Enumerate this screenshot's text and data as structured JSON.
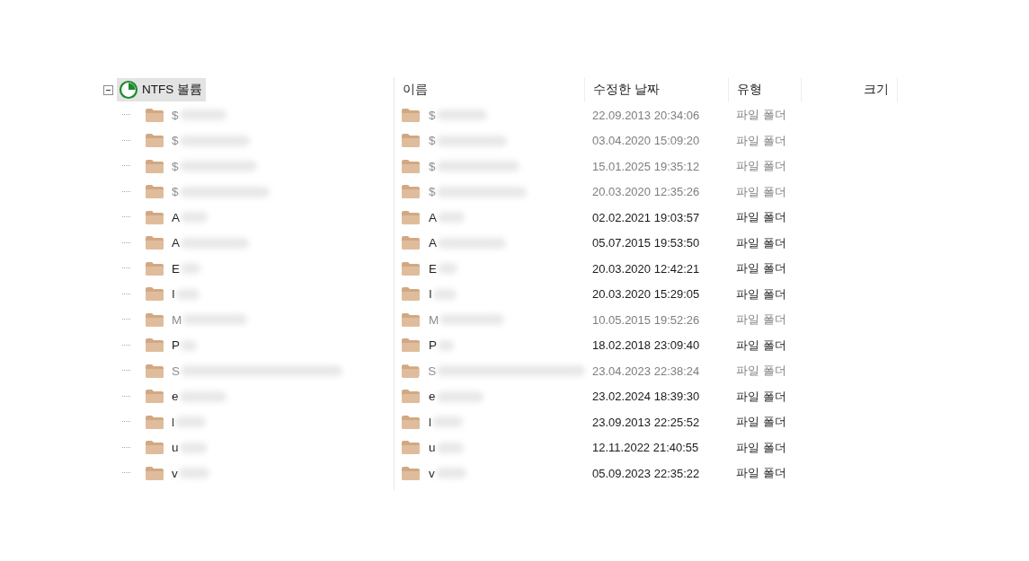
{
  "tree": {
    "label": "NTFS 볼륨",
    "selected": true,
    "expanded": true,
    "children": [
      {
        "name": "$",
        "hidden": true
      },
      {
        "name": "$",
        "hidden": true
      },
      {
        "name": "$",
        "hidden": true
      },
      {
        "name": "$",
        "hidden": true
      },
      {
        "name": "A",
        "hidden": false
      },
      {
        "name": "A",
        "hidden": false
      },
      {
        "name": "E",
        "hidden": false
      },
      {
        "name": "I",
        "hidden": false
      },
      {
        "name": "M",
        "hidden": true
      },
      {
        "name": "P",
        "hidden": false
      },
      {
        "name": "S",
        "hidden": true
      },
      {
        "name": "e",
        "hidden": false
      },
      {
        "name": "l",
        "hidden": false
      },
      {
        "name": "u",
        "hidden": false
      },
      {
        "name": "v",
        "hidden": false
      }
    ]
  },
  "table": {
    "columns": [
      {
        "label": "이름"
      },
      {
        "label": "수정한 날짜"
      },
      {
        "label": "유형"
      },
      {
        "label": "크기"
      }
    ],
    "rows": [
      {
        "name": "$",
        "modified": "22.09.2013 20:34:06",
        "type": "파일 폴더",
        "hidden": true
      },
      {
        "name": "$",
        "modified": "03.04.2020 15:09:20",
        "type": "파일 폴더",
        "hidden": true
      },
      {
        "name": "$",
        "modified": "15.01.2025 19:35:12",
        "type": "파일 폴더",
        "hidden": true
      },
      {
        "name": "$",
        "modified": "20.03.2020 12:35:26",
        "type": "파일 폴더",
        "hidden": true
      },
      {
        "name": "A",
        "modified": "02.02.2021 19:03:57",
        "type": "파일 폴더",
        "hidden": false
      },
      {
        "name": "A",
        "modified": "05.07.2015 19:53:50",
        "type": "파일 폴더",
        "hidden": false
      },
      {
        "name": "E",
        "modified": "20.03.2020 12:42:21",
        "type": "파일 폴더",
        "hidden": false
      },
      {
        "name": "I",
        "modified": "20.03.2020 15:29:05",
        "type": "파일 폴더",
        "hidden": false
      },
      {
        "name": "M",
        "modified": "10.05.2015 19:52:26",
        "type": "파일 폴더",
        "hidden": true
      },
      {
        "name": "P",
        "modified": "18.02.2018 23:09:40",
        "type": "파일 폴더",
        "hidden": false
      },
      {
        "name": "S",
        "modified": "23.04.2023 22:38:24",
        "type": "파일 폴더",
        "hidden": true
      },
      {
        "name": "e",
        "modified": "23.02.2024 18:39:30",
        "type": "파일 폴더",
        "hidden": false
      },
      {
        "name": "l",
        "modified": "23.09.2013 22:25:52",
        "type": "파일 폴더",
        "hidden": false
      },
      {
        "name": "u",
        "modified": "12.11.2022 21:40:55",
        "type": "파일 폴더",
        "hidden": false
      },
      {
        "name": "v",
        "modified": "05.09.2023 22:35:22",
        "type": "파일 폴더",
        "hidden": false
      }
    ]
  }
}
